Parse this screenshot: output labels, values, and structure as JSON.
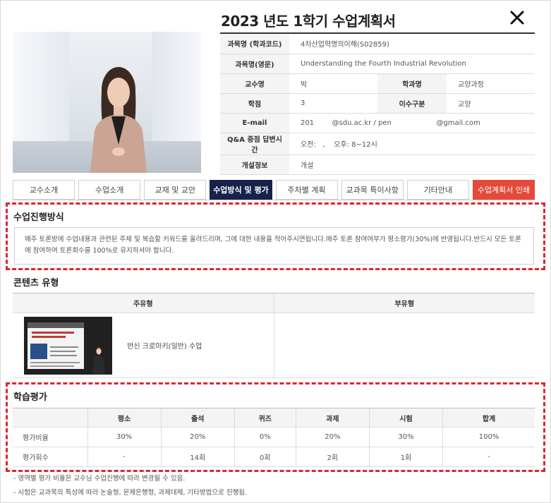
{
  "title": "2023 년도 1학기 수업계획서",
  "info": {
    "rows": [
      {
        "label": "과목명 (학과코드)",
        "value": "4차산업혁명의이해(S02859)"
      },
      {
        "label": "과목명(영문)",
        "value": "Understanding the Fourth Industrial Revolution"
      },
      {
        "label": "교수명",
        "value": "박",
        "label2": "학과명",
        "value2": "교양과정"
      },
      {
        "label": "학점",
        "value": "3",
        "label2": "이수구분",
        "value2": "교양"
      },
      {
        "label": "E-mail",
        "value": "201        @sdu.ac.kr / pen                    @gmail.com"
      },
      {
        "label": "Q&A 중점 답변시간",
        "value": "오전:   ,    오후: 8~12시"
      },
      {
        "label": "개설정보",
        "value": "개설"
      }
    ]
  },
  "tabs": [
    {
      "label": "교수소개"
    },
    {
      "label": "수업소개"
    },
    {
      "label": "교재 및 교안"
    },
    {
      "label": "수업방식 및 평가"
    },
    {
      "label": "주차별 계획"
    },
    {
      "label": "교과목 특이사항"
    },
    {
      "label": "기타안내"
    },
    {
      "label": "수업계획서 인쇄"
    }
  ],
  "method": {
    "title": "수업진행방식",
    "text": "매주 토론방에 수업내용과 관련된 주제 및 복습할 키워드를 올려드리며, 그에 대한 내용을 적어주시면됩니다.매주 토론 참여여부가 평소평가(30%)에 반영됩니다.반드시 모든 토론에 참여하여 토론회수를 100%로 유지하셔야 합니다."
  },
  "content": {
    "title": "콘텐츠 유형",
    "headers": [
      "주유형",
      "부유형"
    ],
    "main_label": "반신 크로마키(일반) 수업",
    "sub_label": ""
  },
  "grading": {
    "title": "학습평가",
    "headers": [
      "",
      "평소",
      "출석",
      "퀴즈",
      "과제",
      "시험",
      "합계"
    ],
    "rows": [
      [
        "평가비율",
        "30%",
        "20%",
        "0%",
        "20%",
        "30%",
        "100%"
      ],
      [
        "평가회수",
        "-",
        "14회",
        "0회",
        "2회",
        "1회",
        "-"
      ]
    ]
  },
  "notes": [
    "- 영역별 평가 비율은 교수님 수업진행에 따라 변경될 수 있음.",
    "- 시험은 교과목의 특성에 따라 논술형, 문제은행형, 과제대체, 기타방법으로 진행됨."
  ],
  "colors": {
    "active_tab": "#17224a",
    "print_tab": "#e44a3a",
    "highlight_box": "#e0262a"
  }
}
